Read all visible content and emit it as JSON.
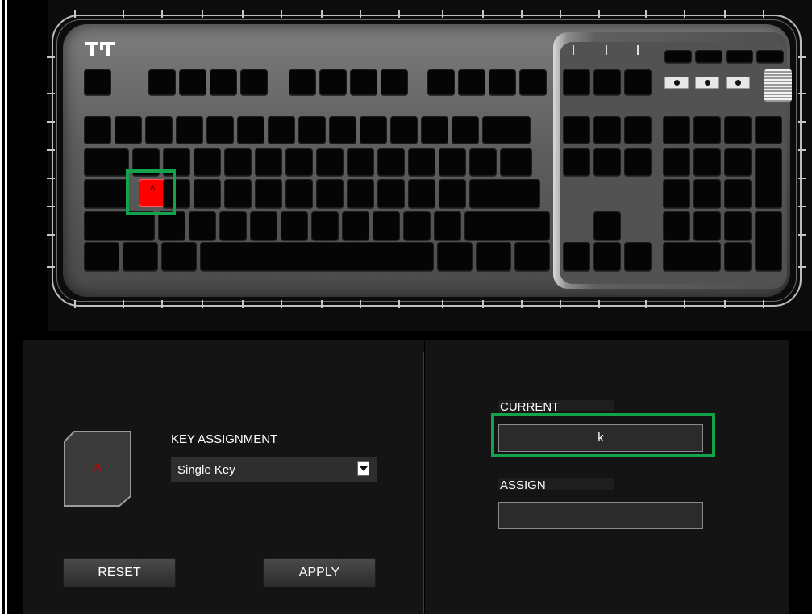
{
  "keyboard": {
    "brand_logo": "thermaltake-tt-logo",
    "selected_key": {
      "label": "A",
      "color": "#ff0000"
    },
    "highlight_color": "#15a24c",
    "media_buttons": [
      "cloud-icon",
      "lightbulb-icon",
      "settings-icon"
    ]
  },
  "key_preview": {
    "letter": "A",
    "letter_color": "#d40000"
  },
  "key_assignment": {
    "heading": "KEY ASSIGNMENT",
    "selected_option": "Single Key"
  },
  "current": {
    "label": "CURRENT",
    "value": "k"
  },
  "assign": {
    "label": "ASSIGN",
    "value": ""
  },
  "buttons": {
    "reset": "RESET",
    "apply": "APPLY"
  }
}
